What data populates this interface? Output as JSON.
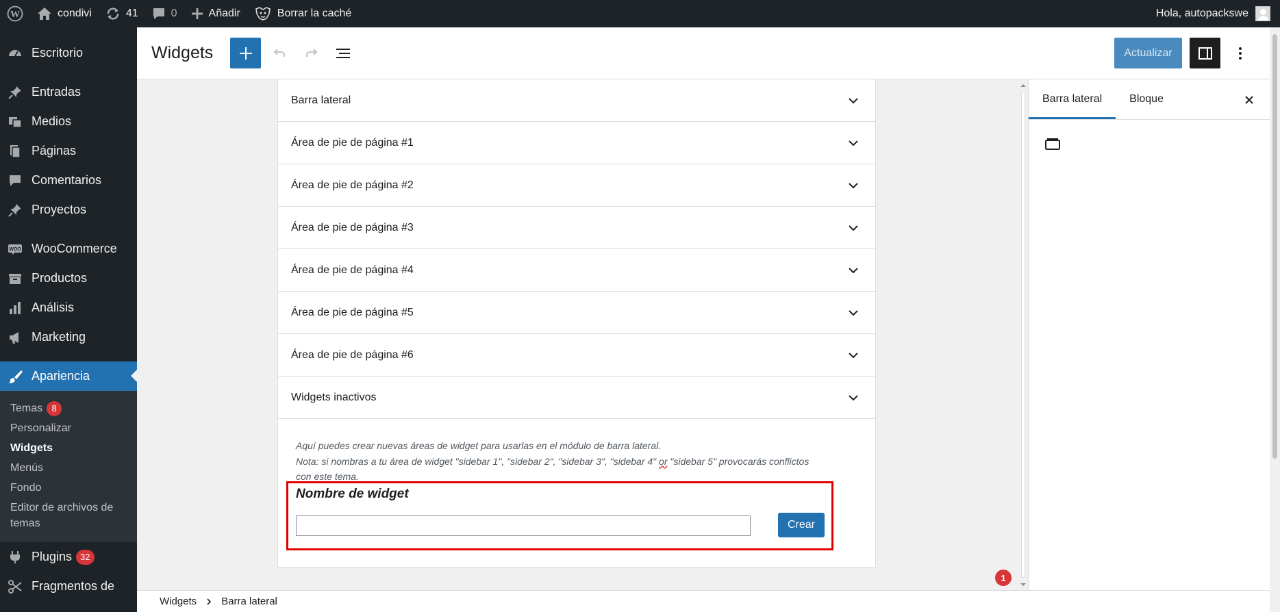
{
  "adminbar": {
    "site_name": "condivi",
    "updates_count": "41",
    "comments_count": "0",
    "add_label": "Añadir",
    "cache_label": "Borrar la caché",
    "greeting": "Hola, autopackswe"
  },
  "sidebar": {
    "items": [
      {
        "label": "Escritorio"
      },
      {
        "label": "Entradas"
      },
      {
        "label": "Medios"
      },
      {
        "label": "Páginas"
      },
      {
        "label": "Comentarios"
      },
      {
        "label": "Proyectos"
      },
      {
        "label": "WooCommerce"
      },
      {
        "label": "Productos"
      },
      {
        "label": "Análisis"
      },
      {
        "label": "Marketing"
      },
      {
        "label": "Apariencia"
      },
      {
        "label": "Plugins",
        "badge": "32"
      },
      {
        "label": "Fragmentos de"
      }
    ],
    "submenu": [
      {
        "label": "Temas",
        "badge": "8"
      },
      {
        "label": "Personalizar"
      },
      {
        "label": "Widgets"
      },
      {
        "label": "Menús"
      },
      {
        "label": "Fondo"
      },
      {
        "label": "Editor de archivos de temas"
      }
    ]
  },
  "header": {
    "title": "Widgets",
    "update_label": "Actualizar"
  },
  "widget_areas": [
    "Barra lateral",
    "Área de pie de página #1",
    "Área de pie de página #2",
    "Área de pie de página #3",
    "Área de pie de página #4",
    "Área de pie de página #5",
    "Área de pie de página #6",
    "Widgets inactivos"
  ],
  "create_area": {
    "help_line1": "Aquí puedes crear nuevas áreas de widget para usarlas en el módulo de barra lateral.",
    "help_line2_pre": "Nota: si nombras a tu área de widget \"sidebar 1\", \"sidebar 2\", \"sidebar 3\", \"sidebar 4\" ",
    "help_line2_or": "or",
    "help_line2_post": " \"sidebar 5\" provocarás conflictos",
    "help_line3": "con este tema.",
    "label": "Nombre de widget",
    "input_value": "",
    "button_label": "Crear"
  },
  "notice_count": "1",
  "right_panel": {
    "tab_sidebar": "Barra lateral",
    "tab_block": "Bloque"
  },
  "breadcrumb": {
    "root": "Widgets",
    "current": "Barra lateral"
  },
  "colors": {
    "admin_dark": "#1d2327",
    "accent": "#2271b1",
    "highlight_red": "#e00000",
    "badge_red": "#d63638"
  }
}
